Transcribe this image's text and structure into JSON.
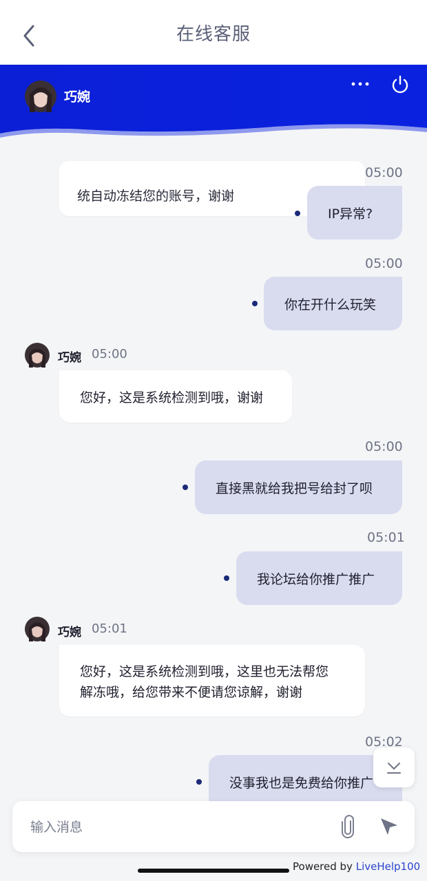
{
  "header": {
    "title": "在线客服",
    "back_icon": "chevron-left-icon"
  },
  "agent": {
    "name": "巧婉",
    "more_icon": "more-horizontal-icon",
    "power_icon": "power-icon"
  },
  "colors": {
    "banner": "#0b1fd6",
    "outgoing_bubble": "#d9dcef",
    "incoming_bubble": "#ffffff",
    "unread_dot": "#1a2a78",
    "brand_link": "#2a44cc"
  },
  "partial_message": "统自动冻结您的账号，谢谢",
  "messages": [
    {
      "dir": "out",
      "time": "05:00",
      "text": "IP异常?"
    },
    {
      "dir": "out",
      "time": "05:00",
      "text": "你在开什么玩笑"
    },
    {
      "dir": "in",
      "name": "巧婉",
      "time": "05:00",
      "text": "您好，这是系统检测到哦，谢谢"
    },
    {
      "dir": "out",
      "time": "05:00",
      "text": "直接黑就给我把号给封了呗"
    },
    {
      "dir": "out",
      "time": "05:01",
      "text": "我论坛给你推广推广"
    },
    {
      "dir": "in",
      "name": "巧婉",
      "time": "05:01",
      "line1": "您好，这是系统检测到哦，这里也无法帮您",
      "line2": "解冻哦，给您带来不便请您谅解，谢谢"
    },
    {
      "dir": "out",
      "time": "05:02",
      "text": "没事我也是免费给你推广"
    }
  ],
  "input": {
    "placeholder": "输入消息",
    "attach_icon": "paperclip-icon",
    "send_icon": "send-arrow-icon",
    "scroll_icon": "scroll-down-icon"
  },
  "footer": {
    "powered_prefix": "Powered by ",
    "brand": "LiveHelp100"
  }
}
